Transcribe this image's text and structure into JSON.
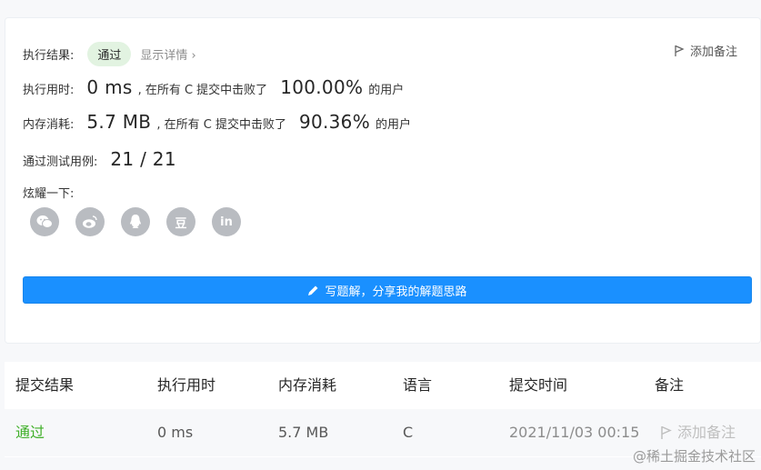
{
  "result": {
    "label": "执行结果:",
    "status": "通过",
    "details_link": "显示详情 ›",
    "add_note": "添加备注"
  },
  "runtime": {
    "label": "执行用时:",
    "value": "0 ms",
    "mid": ", 在所有 C 提交中击败了",
    "percent": "100.00%",
    "suffix": "的用户"
  },
  "memory": {
    "label": "内存消耗:",
    "value": "5.7 MB",
    "mid": ", 在所有 C 提交中击败了",
    "percent": "90.36%",
    "suffix": "的用户"
  },
  "tests": {
    "label": "通过测试用例:",
    "value": "21 / 21"
  },
  "share": {
    "label": "炫耀一下:",
    "icons": [
      "wechat-icon",
      "weibo-icon",
      "qq-icon",
      "douban-icon",
      "linkedin-icon"
    ],
    "douban_glyph": "豆",
    "linkedin_glyph": "in"
  },
  "write_solution": "写题解，分享我的解题思路",
  "table": {
    "headers": [
      "提交结果",
      "执行用时",
      "内存消耗",
      "语言",
      "提交时间",
      "备注"
    ],
    "rows": [
      {
        "result": "通过",
        "runtime": "0 ms",
        "memory": "5.7 MB",
        "language": "C",
        "time": "2021/11/03 00:15",
        "note": "添加备注"
      }
    ]
  },
  "watermark": "@稀土掘金技术社区",
  "colors": {
    "accent": "#1a90ff",
    "pass": "#3faf28",
    "pill_bg": "#e2f3e1"
  }
}
